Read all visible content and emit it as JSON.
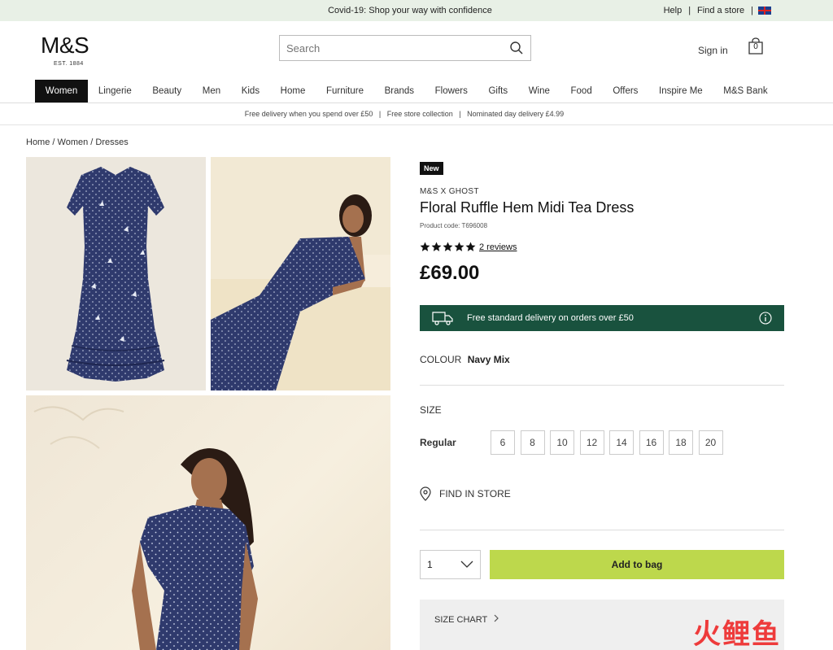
{
  "topbar": {
    "message": "Covid-19: Shop your way with confidence",
    "help": "Help",
    "find_store": "Find a store",
    "separator": "|"
  },
  "header": {
    "logo": "M&S",
    "logo_sub": "EST. 1884",
    "search_placeholder": "Search",
    "signin": "Sign in",
    "bag_count": "0"
  },
  "nav": {
    "items": [
      "Women",
      "Lingerie",
      "Beauty",
      "Men",
      "Kids",
      "Home",
      "Furniture",
      "Brands",
      "Flowers",
      "Gifts",
      "Wine",
      "Food",
      "Offers",
      "Inspire Me",
      "M&S Bank"
    ],
    "active": "Women"
  },
  "promo": "Free delivery when you spend over £50   |   Free store collection   |   Nominated day delivery £4.99",
  "breadcrumb": [
    "Home",
    "Women",
    "Dresses"
  ],
  "product": {
    "badge": "New",
    "brand": "M&S X GHOST",
    "title": "Floral Ruffle Hem Midi Tea Dress",
    "code": "Product code: T696008",
    "rating": 5,
    "reviews": "2 reviews",
    "price": "£69.00",
    "delivery": "Free standard delivery on orders over £50",
    "colour_label": "COLOUR",
    "colour_value": "Navy Mix",
    "size_label": "SIZE",
    "fit_label": "Regular",
    "sizes": [
      "6",
      "8",
      "10",
      "12",
      "14",
      "16",
      "18",
      "20"
    ],
    "find_in_store": "FIND IN STORE",
    "quantity": "1",
    "add_to_bag": "Add to bag",
    "size_chart": "SIZE CHART"
  },
  "colors": {
    "delivery_bg": "#19523e",
    "add_button": "#bdd84c",
    "dress_navy": "#2e3a6e",
    "topbar_bg": "#e8f0e6"
  },
  "watermark": "火鲤鱼"
}
